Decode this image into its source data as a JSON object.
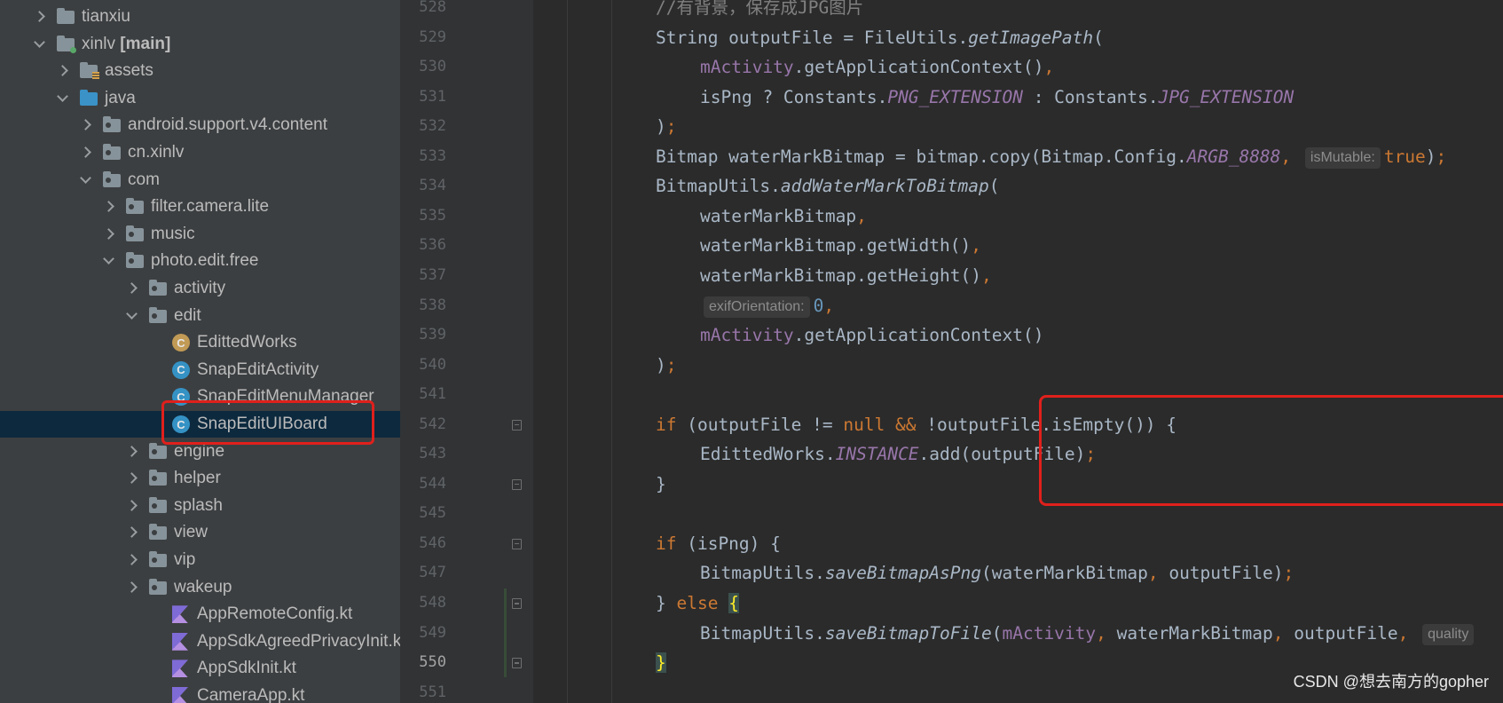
{
  "project_tree": [
    {
      "label": "tianxiu",
      "indent": 0,
      "chevron": "collapsed",
      "icon": "folder"
    },
    {
      "label": "xinlv",
      "suffix": "[main]",
      "indent": 0,
      "chevron": "expanded",
      "icon": "module"
    },
    {
      "label": "assets",
      "indent": 1,
      "chevron": "collapsed",
      "icon": "resource"
    },
    {
      "label": "java",
      "indent": 1,
      "chevron": "expanded",
      "icon": "source"
    },
    {
      "label": "android.support.v4.content",
      "indent": 2,
      "chevron": "collapsed",
      "icon": "package"
    },
    {
      "label": "cn.xinlv",
      "indent": 2,
      "chevron": "collapsed",
      "icon": "package"
    },
    {
      "label": "com",
      "indent": 2,
      "chevron": "expanded",
      "icon": "package"
    },
    {
      "label": "filter.camera.lite",
      "indent": 3,
      "chevron": "collapsed",
      "icon": "package"
    },
    {
      "label": "music",
      "indent": 3,
      "chevron": "collapsed",
      "icon": "package"
    },
    {
      "label": "photo.edit.free",
      "indent": 3,
      "chevron": "expanded",
      "icon": "package"
    },
    {
      "label": "activity",
      "indent": 4,
      "chevron": "collapsed",
      "icon": "package"
    },
    {
      "label": "edit",
      "indent": 4,
      "chevron": "expanded",
      "icon": "package"
    },
    {
      "label": "EdittedWorks",
      "indent": 5,
      "chevron": "none",
      "icon": "object"
    },
    {
      "label": "SnapEditActivity",
      "indent": 5,
      "chevron": "none",
      "icon": "class"
    },
    {
      "label": "SnapEditMenuManager",
      "indent": 5,
      "chevron": "none",
      "icon": "class"
    },
    {
      "label": "SnapEditUIBoard",
      "indent": 5,
      "chevron": "none",
      "icon": "class",
      "selected": true
    },
    {
      "label": "engine",
      "indent": 4,
      "chevron": "collapsed",
      "icon": "package"
    },
    {
      "label": "helper",
      "indent": 4,
      "chevron": "collapsed",
      "icon": "package"
    },
    {
      "label": "splash",
      "indent": 4,
      "chevron": "collapsed",
      "icon": "package"
    },
    {
      "label": "view",
      "indent": 4,
      "chevron": "collapsed",
      "icon": "package"
    },
    {
      "label": "vip",
      "indent": 4,
      "chevron": "collapsed",
      "icon": "package"
    },
    {
      "label": "wakeup",
      "indent": 4,
      "chevron": "collapsed",
      "icon": "package"
    },
    {
      "label": "AppRemoteConfig.kt",
      "indent": 5,
      "chevron": "none",
      "icon": "kotlin"
    },
    {
      "label": "AppSdkAgreedPrivacyInit.kt",
      "indent": 5,
      "chevron": "none",
      "icon": "kotlin"
    },
    {
      "label": "AppSdkInit.kt",
      "indent": 5,
      "chevron": "none",
      "icon": "kotlin"
    },
    {
      "label": "CameraApp.kt",
      "indent": 5,
      "chevron": "none",
      "icon": "kotlin"
    }
  ],
  "editor": {
    "current_line": "550",
    "lines": [
      {
        "num": "528",
        "indent": 0,
        "segs": [
          {
            "t": "//有背景，保存成JPG图片",
            "c": "cmt"
          }
        ]
      },
      {
        "num": "529",
        "indent": 0,
        "segs": [
          {
            "t": "String outputFile = FileUtils."
          },
          {
            "t": "getImagePath",
            "c": "mi"
          },
          {
            "t": "("
          }
        ]
      },
      {
        "num": "530",
        "indent": 1,
        "segs": [
          {
            "t": "mActivity",
            "c": "fld"
          },
          {
            "t": ".getApplicationContext()"
          },
          {
            "t": ",",
            "c": "kw"
          }
        ]
      },
      {
        "num": "531",
        "indent": 1,
        "segs": [
          {
            "t": "isPng ? Constants."
          },
          {
            "t": "PNG_EXTENSION",
            "c": "fi"
          },
          {
            "t": " : Constants."
          },
          {
            "t": "JPG_EXTENSION",
            "c": "fi"
          }
        ]
      },
      {
        "num": "532",
        "indent": 0,
        "segs": [
          {
            "t": ")"
          },
          {
            "t": ";",
            "c": "kw"
          }
        ]
      },
      {
        "num": "533",
        "indent": 0,
        "segs": [
          {
            "t": "Bitmap waterMarkBitmap = bitmap.copy(Bitmap.Config."
          },
          {
            "t": "ARGB_8888",
            "c": "fi"
          },
          {
            "t": ", ",
            "c": "kw"
          },
          {
            "hint": "isMutable:"
          },
          {
            "t": "true",
            "c": "kw"
          },
          {
            "t": ")"
          },
          {
            "t": ";",
            "c": "kw"
          }
        ]
      },
      {
        "num": "534",
        "indent": 0,
        "segs": [
          {
            "t": "BitmapUtils."
          },
          {
            "t": "addWaterMarkToBitmap",
            "c": "mi"
          },
          {
            "t": "("
          }
        ]
      },
      {
        "num": "535",
        "indent": 1,
        "segs": [
          {
            "t": "waterMarkBitmap"
          },
          {
            "t": ",",
            "c": "kw"
          }
        ]
      },
      {
        "num": "536",
        "indent": 1,
        "segs": [
          {
            "t": "waterMarkBitmap.getWidth()"
          },
          {
            "t": ",",
            "c": "kw"
          }
        ]
      },
      {
        "num": "537",
        "indent": 1,
        "segs": [
          {
            "t": "waterMarkBitmap.getHeight()"
          },
          {
            "t": ",",
            "c": "kw"
          }
        ]
      },
      {
        "num": "538",
        "indent": 1,
        "segs": [
          {
            "hint": "exifOrientation:"
          },
          {
            "t": "0",
            "c": "num"
          },
          {
            "t": ",",
            "c": "kw"
          }
        ]
      },
      {
        "num": "539",
        "indent": 1,
        "segs": [
          {
            "t": "mActivity",
            "c": "fld"
          },
          {
            "t": ".getApplicationContext()"
          }
        ]
      },
      {
        "num": "540",
        "indent": 0,
        "segs": [
          {
            "t": ")"
          },
          {
            "t": ";",
            "c": "kw"
          }
        ]
      },
      {
        "num": "541",
        "indent": 0,
        "segs": []
      },
      {
        "num": "542",
        "indent": 0,
        "fold": true,
        "segs": [
          {
            "t": "if",
            "c": "kw"
          },
          {
            "t": " (outputFile != "
          },
          {
            "t": "null",
            "c": "kw"
          },
          {
            "t": " && ",
            "c": "kw"
          },
          {
            "t": "!outputFile.isEmpty()) {"
          }
        ]
      },
      {
        "num": "543",
        "indent": 1,
        "segs": [
          {
            "t": "EdittedWorks."
          },
          {
            "t": "INSTANCE",
            "c": "fi"
          },
          {
            "t": ".add(outputFile)"
          },
          {
            "t": ";",
            "c": "kw"
          }
        ]
      },
      {
        "num": "544",
        "indent": 0,
        "fold": true,
        "segs": [
          {
            "t": "}"
          }
        ]
      },
      {
        "num": "545",
        "indent": 0,
        "segs": []
      },
      {
        "num": "546",
        "indent": 0,
        "fold": true,
        "segs": [
          {
            "t": "if",
            "c": "kw"
          },
          {
            "t": " (isPng) {"
          }
        ]
      },
      {
        "num": "547",
        "indent": 1,
        "segs": [
          {
            "t": "BitmapUtils."
          },
          {
            "t": "saveBitmapAsPng",
            "c": "mi"
          },
          {
            "t": "(waterMarkBitmap"
          },
          {
            "t": ", ",
            "c": "kw"
          },
          {
            "t": "outputFile)"
          },
          {
            "t": ";",
            "c": "kw"
          }
        ]
      },
      {
        "num": "548",
        "indent": 0,
        "fold": true,
        "segs": [
          {
            "t": "} "
          },
          {
            "t": "else",
            "c": "kw"
          },
          {
            "t": " "
          },
          {
            "t": "{",
            "c": "brace-hl"
          }
        ]
      },
      {
        "num": "549",
        "indent": 1,
        "segs": [
          {
            "t": "BitmapUtils."
          },
          {
            "t": "saveBitmapToFile",
            "c": "mi"
          },
          {
            "t": "("
          },
          {
            "t": "mActivity",
            "c": "fld"
          },
          {
            "t": ", ",
            "c": "kw"
          },
          {
            "t": "waterMarkBitmap"
          },
          {
            "t": ", ",
            "c": "kw"
          },
          {
            "t": "outputFile"
          },
          {
            "t": ", ",
            "c": "kw"
          },
          {
            "hint": "quality"
          }
        ]
      },
      {
        "num": "550",
        "indent": 0,
        "fold": true,
        "segs": [
          {
            "t": "}",
            "c": "brace-hl"
          }
        ]
      },
      {
        "num": "551",
        "indent": 0,
        "segs": []
      }
    ]
  },
  "watermark": "CSDN @想去南方的gopher"
}
